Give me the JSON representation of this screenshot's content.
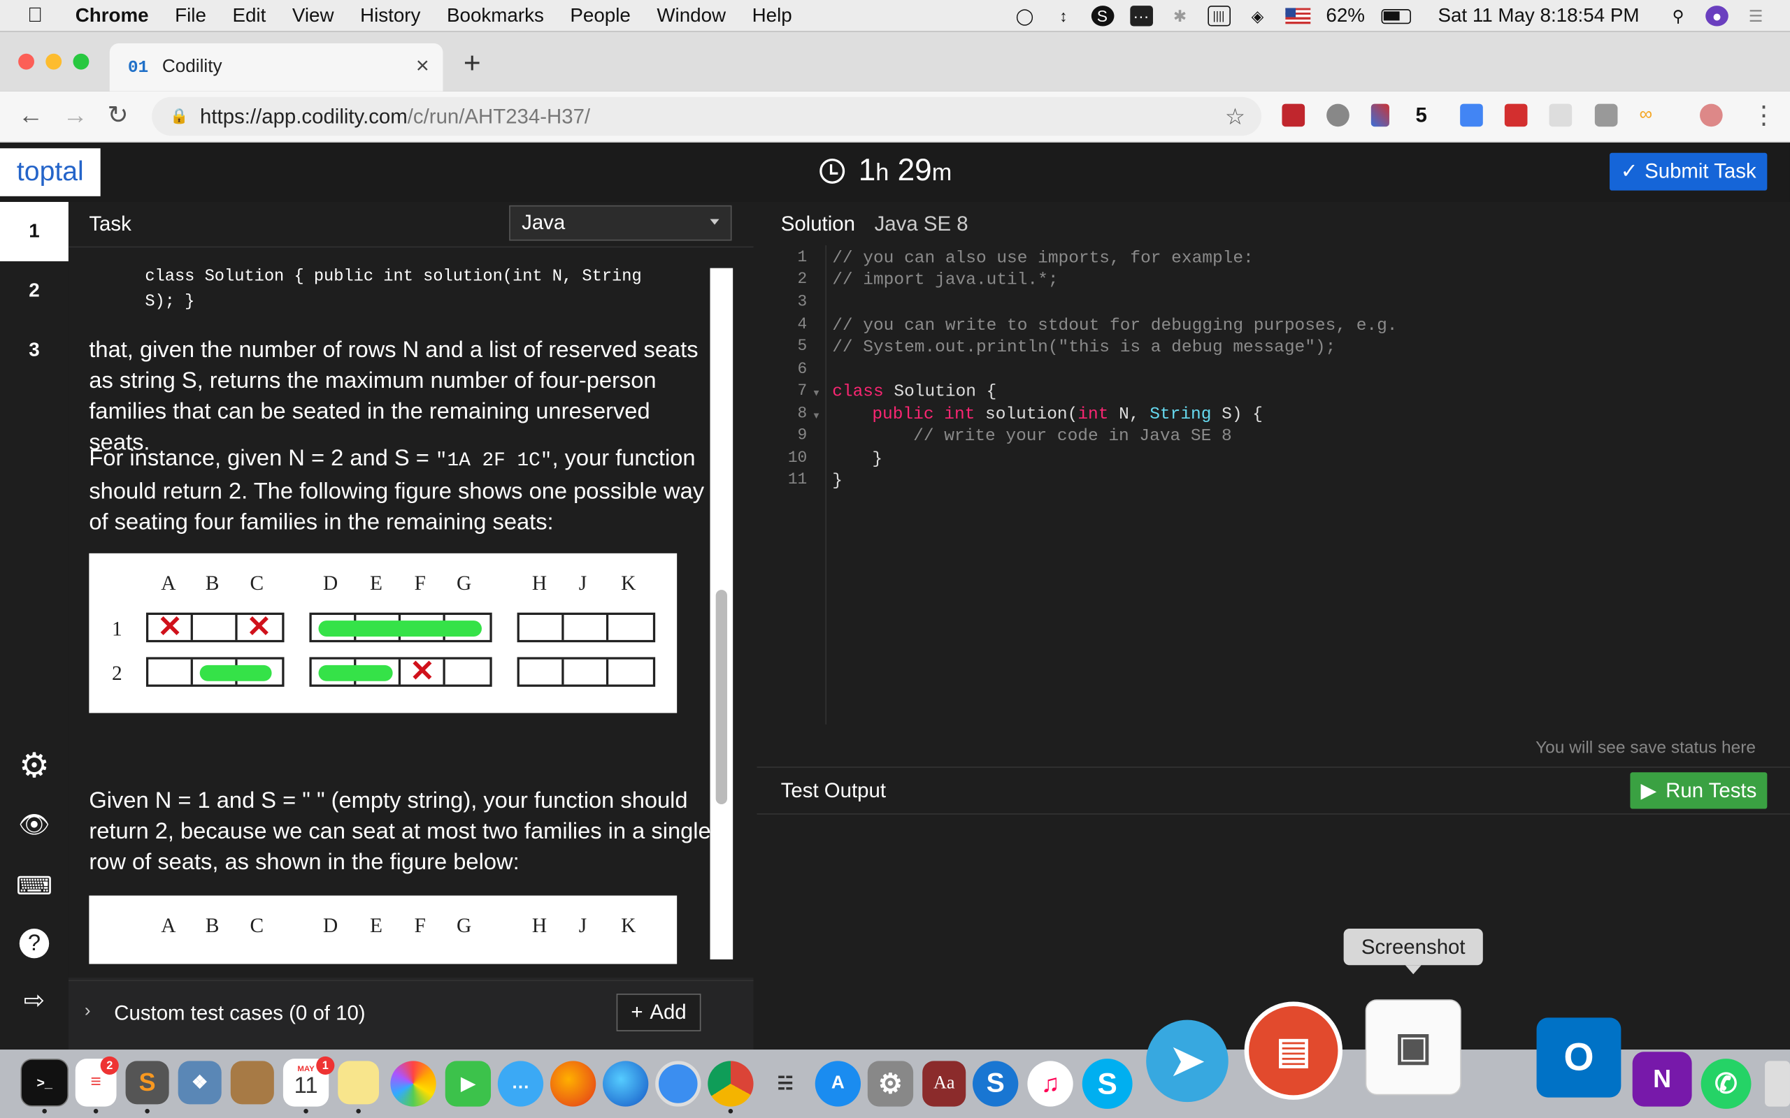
{
  "menubar": {
    "app": "Chrome",
    "items": [
      "File",
      "Edit",
      "View",
      "History",
      "Bookmarks",
      "People",
      "Window",
      "Help"
    ],
    "battery": "62%",
    "datetime": "Sat 11 May  8:18:54 PM"
  },
  "browser": {
    "tab_title": "Codility",
    "tab_favicon": "01",
    "url_host": "https://app.codility.com",
    "url_path": "/c/run/AHT234-H37/"
  },
  "app": {
    "logo": "toptal",
    "timer_hours": "1",
    "timer_h": "h",
    "timer_minutes": "29",
    "timer_m": "m",
    "submit_label": "Submit Task"
  },
  "nav": {
    "tasks": [
      "1",
      "2",
      "3"
    ]
  },
  "task": {
    "header": "Task",
    "language": "Java",
    "signature_line1": "class Solution { public int solution(int N, String",
    "signature_line2": "S); }",
    "para1": "that, given the number of rows N and a list of reserved seats as string S, returns the maximum number of four-person families that can be seated in the remaining unreserved seats.",
    "para2_a": "For instance, given N = 2 and S = ",
    "para2_code": "\"1A 2F 1C\"",
    "para2_b": ", your function should return 2. The following figure shows one possible way of seating four families in the remaining seats:",
    "para3": "Given N = 1 and S = \" \" (empty string), your function should return 2, because we can seat at most two families in a single row of seats, as shown in the figure below:",
    "seat_letters": [
      "A",
      "B",
      "C",
      "D",
      "E",
      "F",
      "G",
      "H",
      "J",
      "K"
    ],
    "row_labels": [
      "1",
      "2"
    ],
    "custom_tests": "Custom test cases (0 of 10)",
    "add_label": "Add"
  },
  "editor": {
    "title": "Solution",
    "language": "Java SE 8",
    "line_numbers": [
      "1",
      "2",
      "3",
      "4",
      "5",
      "6",
      "7",
      "8",
      "9",
      "10",
      "11"
    ],
    "code": {
      "l1": "// you can also use imports, for example:",
      "l2": "// import java.util.*;",
      "l4": "// you can write to stdout for debugging purposes, e.g.",
      "l5": "// System.out.println(\"this is a debug message\");",
      "l7_kw": "class",
      "l7_rest": " Solution {",
      "l8_kw1": "public",
      "l8_kw2": "int",
      "l8_mid": " solution(",
      "l8_kw3": "int",
      "l8_mid2": " N, ",
      "l8_ty": "String",
      "l8_end": " S) {",
      "l9": "// write your code in Java SE 8",
      "l10": "}",
      "l11": "}"
    },
    "save_status": "You will see save status here"
  },
  "test_output": {
    "title": "Test Output",
    "run_label": "Run Tests",
    "tooltip": "Screenshot"
  },
  "dock": {
    "calendar_month": "MAY",
    "calendar_day": "11",
    "badge_notes": "2",
    "badge_calendar": "1"
  }
}
